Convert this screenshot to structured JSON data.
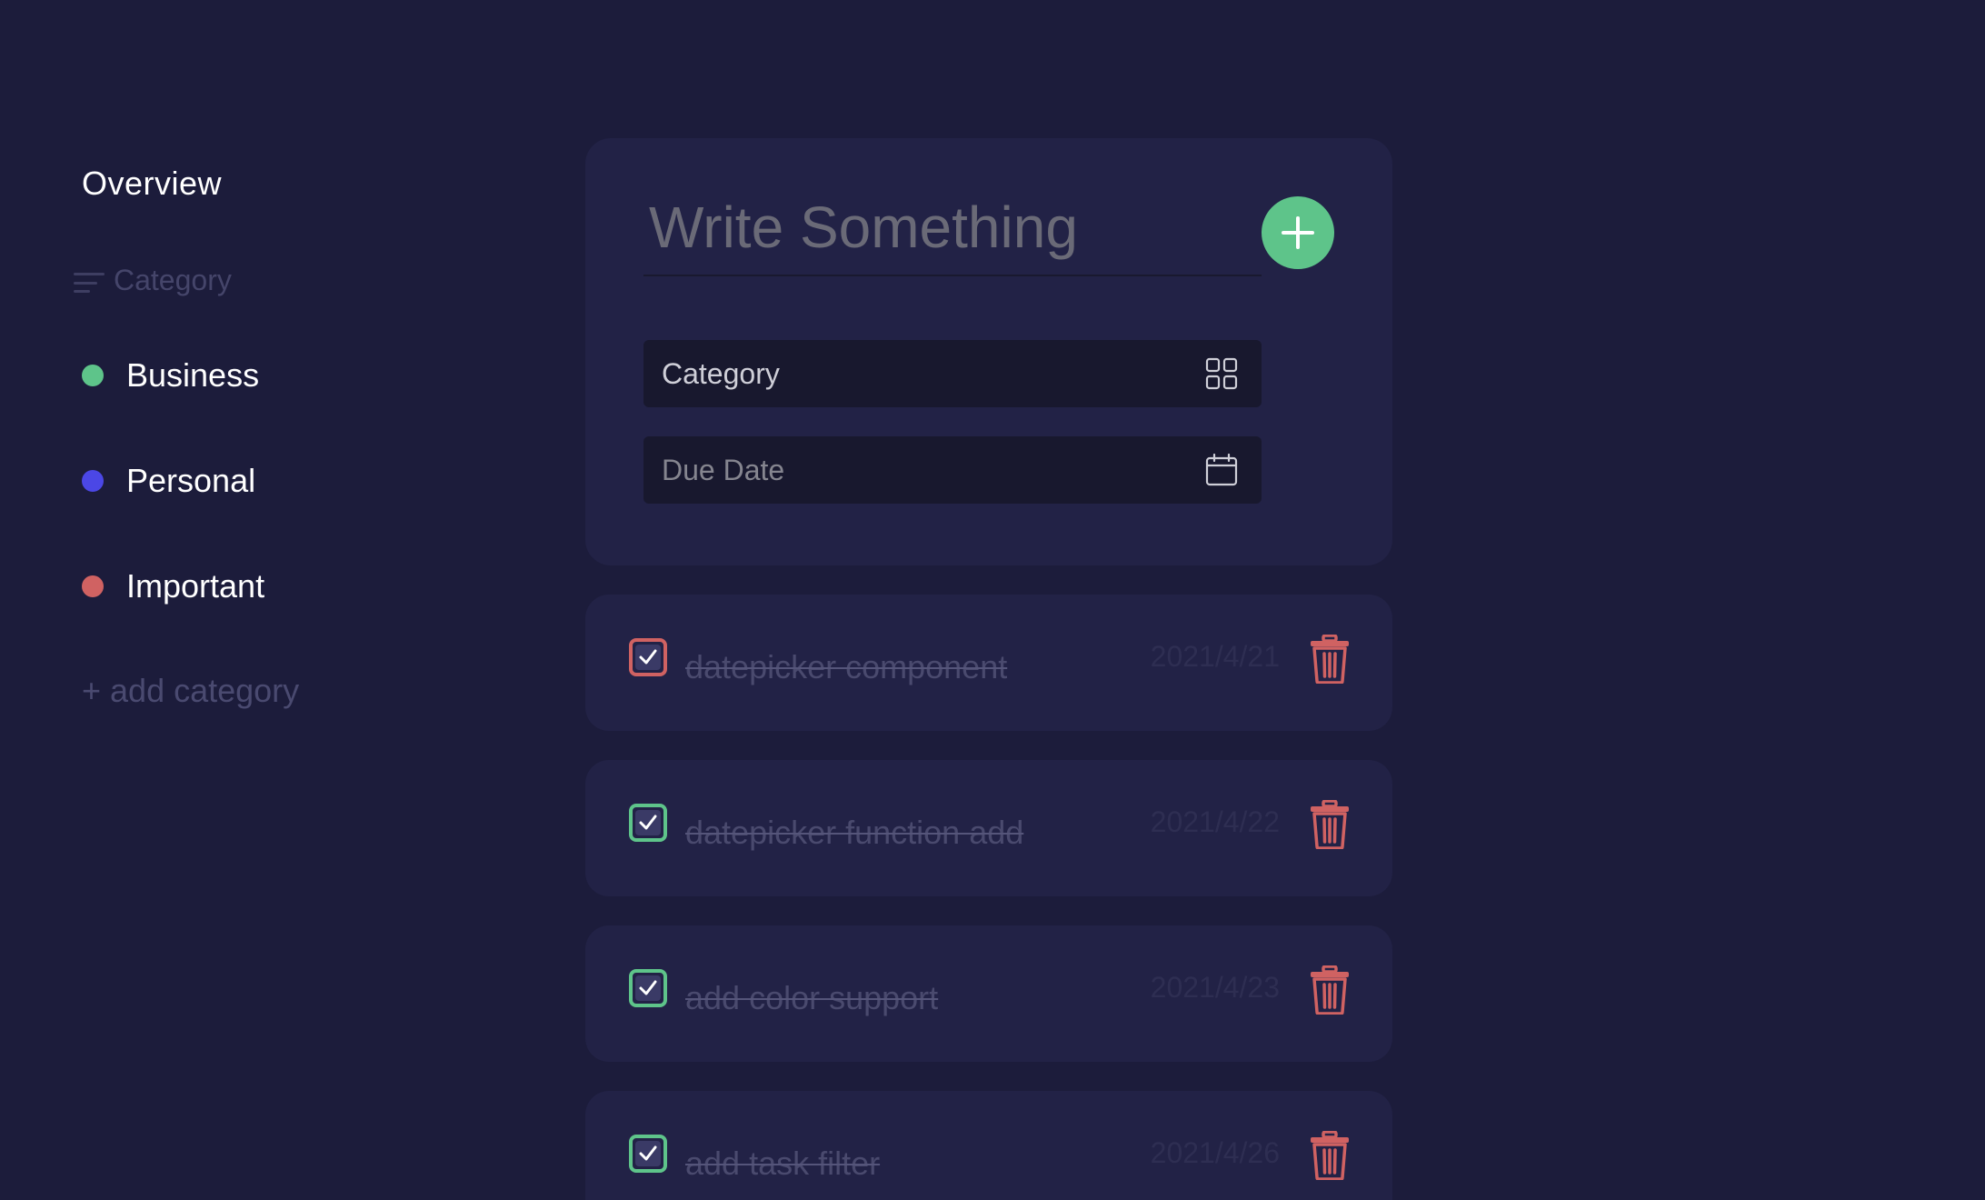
{
  "sidebar": {
    "overview_label": "Overview",
    "category_header": "Category",
    "categories": [
      {
        "label": "Business",
        "color": "#5ec48a"
      },
      {
        "label": "Personal",
        "color": "#4b47e6"
      },
      {
        "label": "Important",
        "color": "#d06262"
      }
    ],
    "add_category_label": "+ add category"
  },
  "composer": {
    "title_placeholder": "Write Something",
    "category_label": "Category",
    "due_date_label": "Due Date",
    "icons": {
      "add": "plus-icon",
      "category": "grid-icon",
      "due_date": "calendar-icon"
    }
  },
  "tasks": [
    {
      "title": "datepicker component",
      "date": "2021/4/21",
      "done": true,
      "category_color": "#d06262"
    },
    {
      "title": "datepicker function add",
      "date": "2021/4/22",
      "done": true,
      "category_color": "#5ec48a"
    },
    {
      "title": "add color support",
      "date": "2021/4/23",
      "done": true,
      "category_color": "#5ec48a"
    },
    {
      "title": "add task filter",
      "date": "2021/4/26",
      "done": true,
      "category_color": "#5ec48a"
    }
  ],
  "colors": {
    "background": "#1c1c3b",
    "panel": "#222246",
    "accent_green": "#5ec48a",
    "delete_red": "#d06262"
  }
}
